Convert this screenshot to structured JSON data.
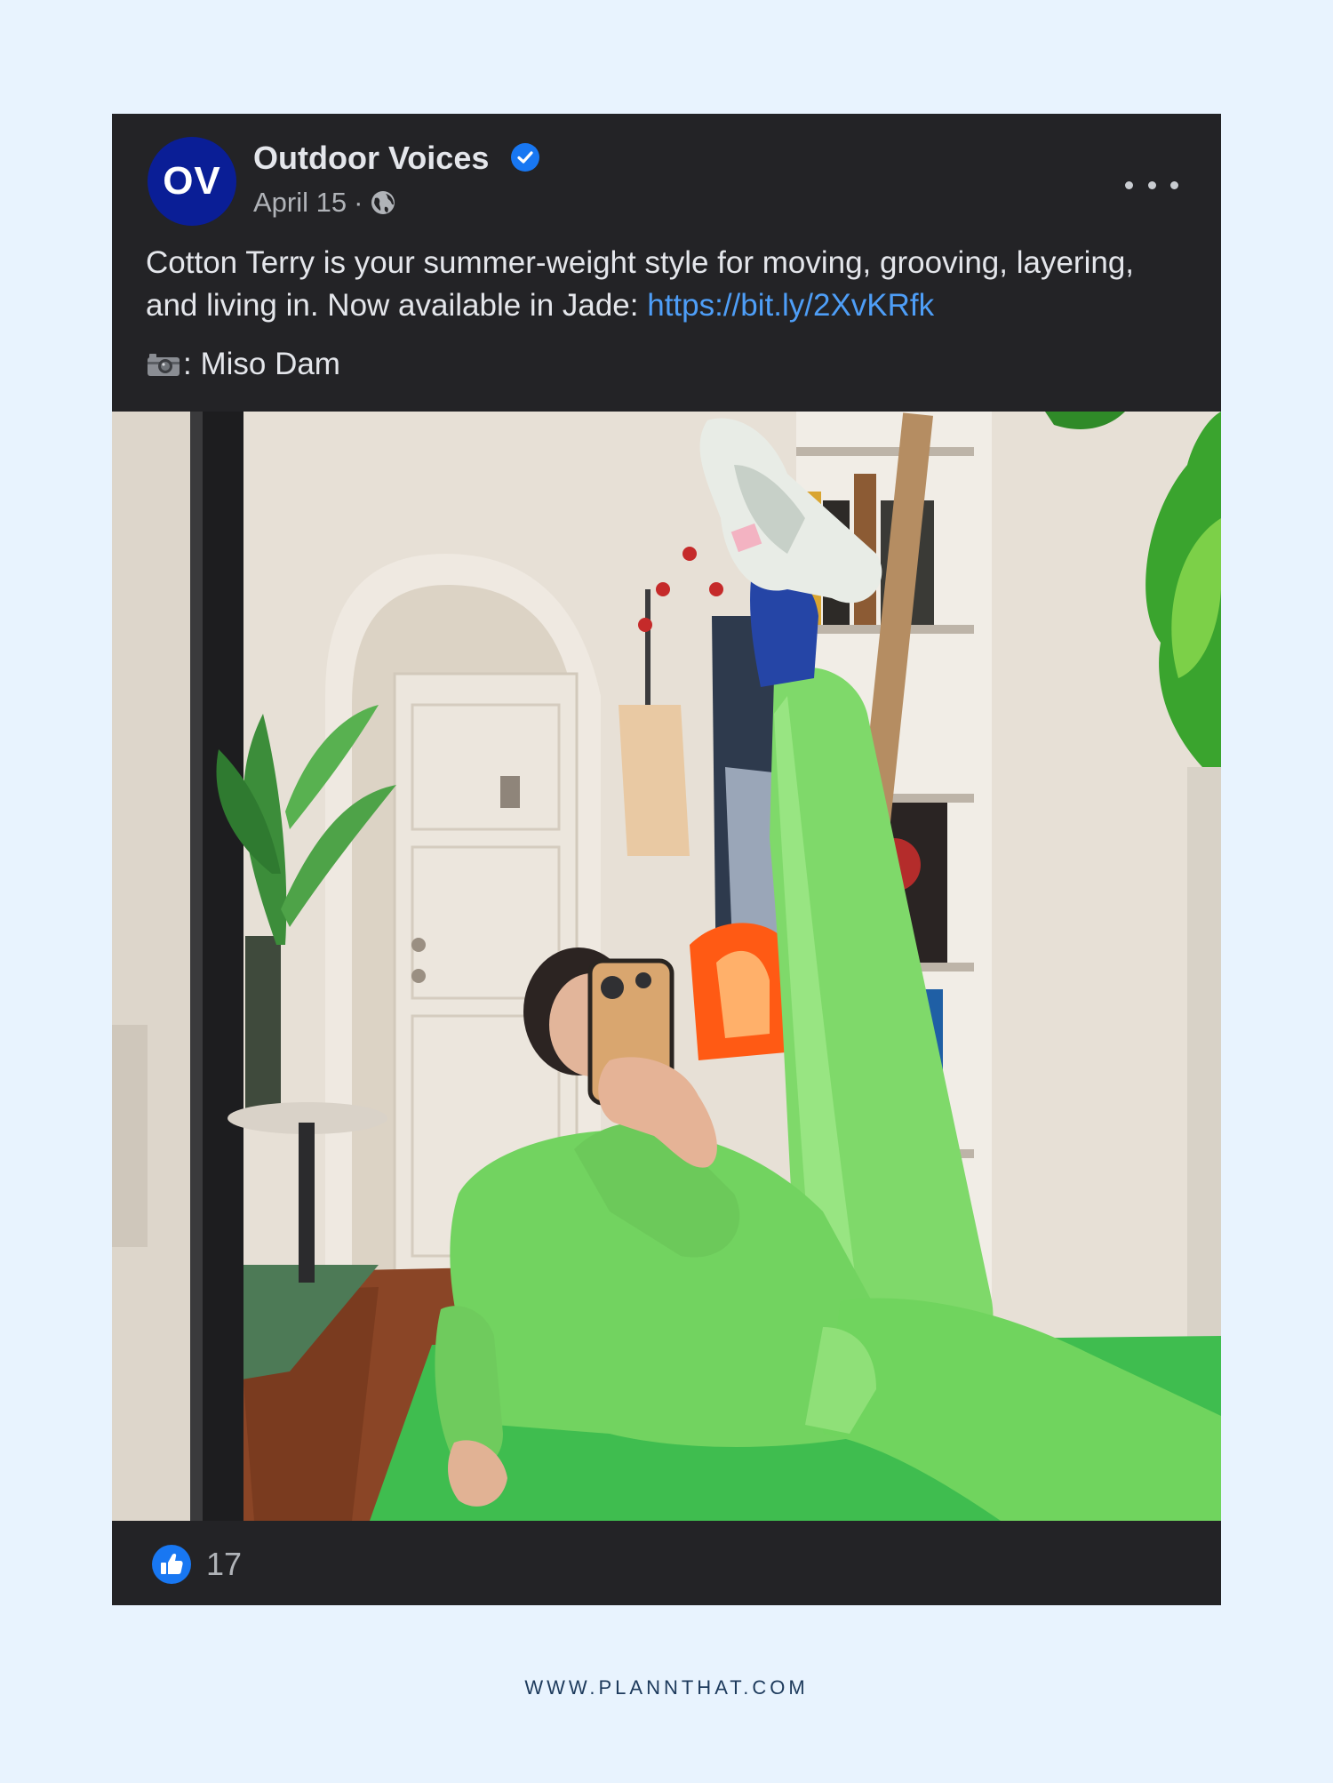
{
  "post": {
    "avatar_text": "OV",
    "page_name": "Outdoor Voices",
    "date": "April 15",
    "separator": "·",
    "caption_text": "Cotton Terry is your summer-weight style for moving, grooving, layering, and living in. Now available in Jade: ",
    "caption_link": "https://bit.ly/2XvKRfk",
    "credit": ": Miso Dam",
    "like_count": "17"
  },
  "icons": {
    "verified": "verified-badge-icon",
    "privacy": "globe-icon",
    "menu": "more-options-icon",
    "camera": "camera-icon",
    "like": "like-thumb-icon"
  },
  "colors": {
    "page_background": "#e8f3fe",
    "card_background": "#232326",
    "avatar": "#0a1e96",
    "link": "#4e9ef7",
    "like_blue": "#1877f2",
    "jade": "#7fd96a"
  },
  "footer": {
    "website": "WWW.PLANNTHAT.COM"
  }
}
